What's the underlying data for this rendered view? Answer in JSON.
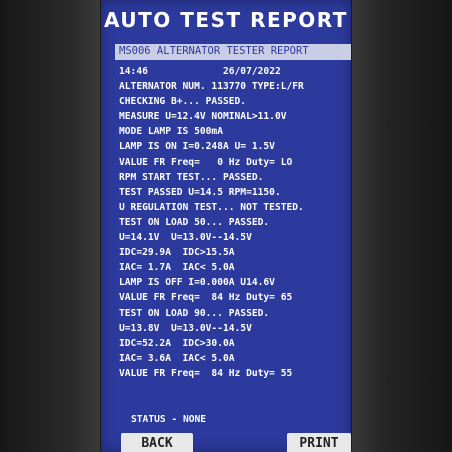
{
  "header": {
    "title": "AUTO TEST REPORT",
    "subtitle": "MS006 ALTERNATOR TESTER REPORT"
  },
  "report": {
    "time": "14:46",
    "date": "26/07/2022",
    "lines": [
      "ALTERNATOR NUM. 113770 TYPE:L/FR",
      "CHECKING B+... PASSED.",
      "MEASURE U=12.4V NOMINAL>11.0V",
      "MODE LAMP IS 500mA",
      "LAMP IS ON I=0.248A U= 1.5V",
      "VALUE FR Freq=   0 Hz Duty= LO",
      "RPM START TEST... PASSED.",
      "TEST PASSED U=14.5 RPM=1150.",
      "U REGULATION TEST... NOT TESTED.",
      "TEST ON LOAD 50... PASSED.",
      "U=14.1V  U=13.0V--14.5V",
      "IDC=29.9A  IDC>15.5A",
      "IAC= 1.7A  IAC< 5.0A",
      "LAMP IS OFF I=0.000A U14.6V",
      "VALUE FR Freq=  84 Hz Duty= 65",
      "TEST ON LOAD 90... PASSED.",
      "U=13.8V  U=13.0V--14.5V",
      "IDC=52.2A  IDC>30.0A",
      "IAC= 3.6A  IAC< 5.0A",
      "VALUE FR Freq=  84 Hz Duty= 55"
    ]
  },
  "status": "STATUS - NONE",
  "buttons": {
    "back": "BACK",
    "print": "PRINT"
  },
  "colors": {
    "screen_background": "#2b3a9c",
    "subtitle_bar": "#c9cde6",
    "text": "#ffffff"
  }
}
